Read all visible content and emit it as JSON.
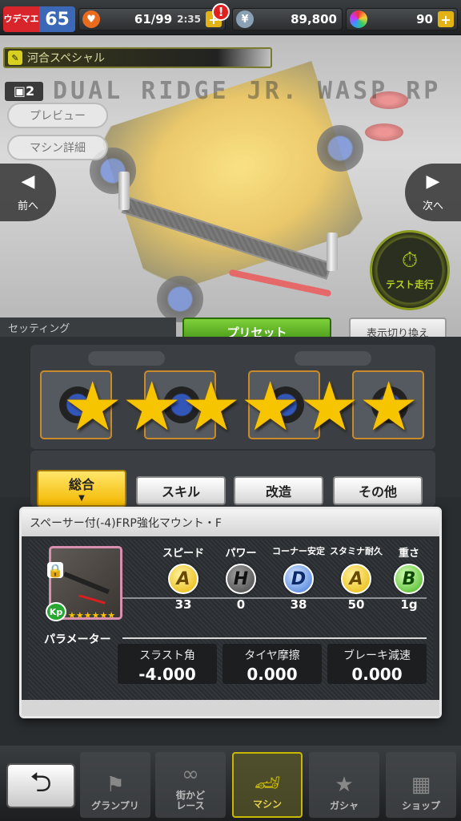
{
  "topbar": {
    "rank_label": "ウデマエ",
    "rank_value": "65",
    "stamina": "61/99",
    "stamina_timer": "2:35",
    "alert": "!",
    "money": "89,800",
    "gems": "90",
    "plus": "+"
  },
  "machine": {
    "custom_name": "河合スペシャル",
    "slot": "2",
    "model_name": "DUAL RIDGE JR. WASP RP",
    "preview_label": "プレビュー",
    "detail_label": "マシン詳細",
    "prev_label": "前へ",
    "next_label": "次へ",
    "test_run_label": "テスト走行",
    "setting_tab_label": "セッティング",
    "preset_label": "プリセット",
    "view_toggle_label": "表示切り換え"
  },
  "rarity_stars": 6,
  "categories": [
    {
      "label": "総合",
      "active": true
    },
    {
      "label": "スキル",
      "active": false
    },
    {
      "label": "改造",
      "active": false
    },
    {
      "label": "その他",
      "active": false
    }
  ],
  "part_detail": {
    "name": "スペーサー付(-4)FRP強化マウント・F",
    "kp_label": "Kp",
    "thumb_stars": "★★★★★★",
    "stats": [
      {
        "label": "スピード",
        "grade": "A",
        "value": "33",
        "color": "yellow"
      },
      {
        "label": "パワー",
        "grade": "H",
        "value": "0",
        "color": "dark"
      },
      {
        "label": "コーナー安定",
        "grade": "D",
        "value": "38",
        "color": "blue"
      },
      {
        "label": "スタミナ耐久",
        "grade": "A",
        "value": "50",
        "color": "yellow"
      },
      {
        "label": "重さ",
        "grade": "B",
        "value": "1g",
        "color": "green"
      }
    ],
    "param_title": "パラメーター",
    "params": [
      {
        "label": "スラスト角",
        "value": "-4.000"
      },
      {
        "label": "タイヤ摩擦",
        "value": "0.000"
      },
      {
        "label": "ブレーキ減速",
        "value": "0.000"
      }
    ]
  },
  "bottom_nav": [
    {
      "label": "グランプリ",
      "icon": "checkered-flag-icon",
      "active": false
    },
    {
      "label": "街かど\nレース",
      "icon": "course-icon",
      "active": false
    },
    {
      "label": "マシン",
      "icon": "car-icon",
      "active": true
    },
    {
      "label": "ガシャ",
      "icon": "star-emblem-icon",
      "active": false
    },
    {
      "label": "ショップ",
      "icon": "shop-icon",
      "active": false
    }
  ]
}
